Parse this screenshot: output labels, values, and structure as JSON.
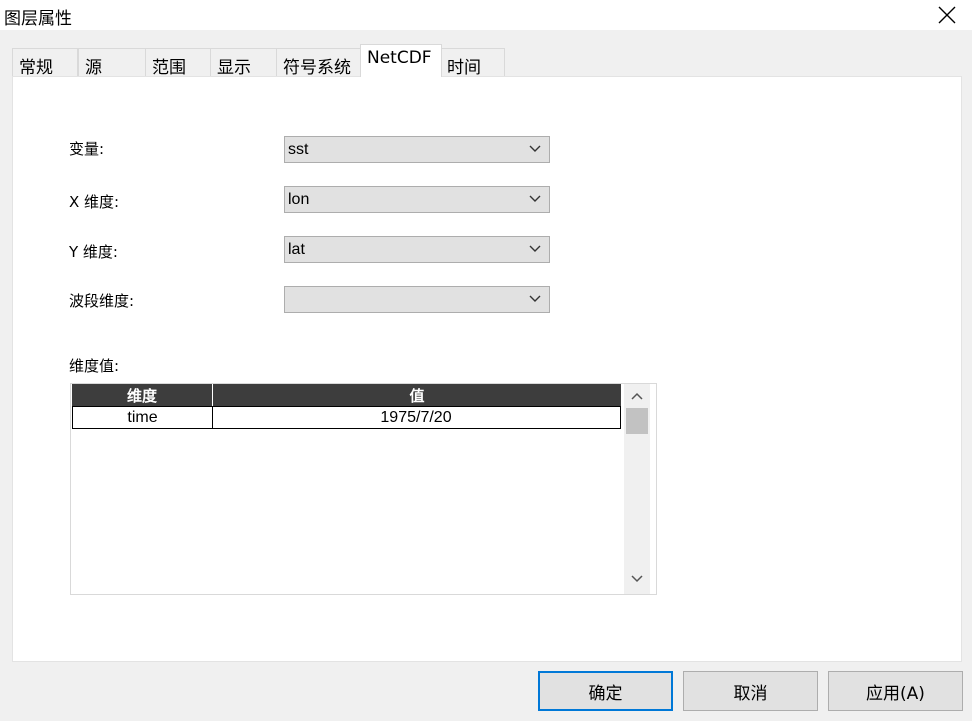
{
  "window": {
    "title": "图层属性"
  },
  "tabs": [
    {
      "label": "常规"
    },
    {
      "label": "源"
    },
    {
      "label": "范围"
    },
    {
      "label": "显示"
    },
    {
      "label": "符号系统"
    },
    {
      "label": "NetCDF",
      "active": true
    },
    {
      "label": "时间"
    }
  ],
  "form": {
    "variable": {
      "label": "变量:",
      "value": "sst"
    },
    "x_dimension": {
      "label": "X 维度:",
      "value": "lon"
    },
    "y_dimension": {
      "label": "Y 维度:",
      "value": "lat"
    },
    "band_dimension": {
      "label": "波段维度:",
      "value": ""
    }
  },
  "dimension_values": {
    "label": "维度值:",
    "columns": [
      "维度",
      "值"
    ],
    "rows": [
      {
        "dimension": "time",
        "value": "1975/7/20"
      }
    ]
  },
  "buttons": {
    "ok": "确定",
    "cancel": "取消",
    "apply": "应用(A)"
  },
  "colors": {
    "accent": "#0078d7",
    "grid_header": "#3d3d3d"
  }
}
